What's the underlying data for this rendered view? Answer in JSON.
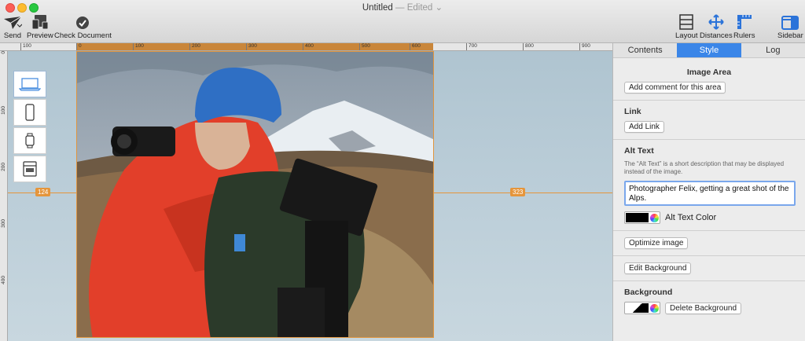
{
  "window": {
    "title": "Untitled",
    "edited": "— Edited",
    "chevron": "⌄"
  },
  "toolbar": {
    "left": [
      {
        "label": "Send",
        "icon": "paper-plane-icon"
      },
      {
        "label": "Preview",
        "icon": "preview-devices-icon"
      },
      {
        "label": "Check Document",
        "icon": "checkmark-circle-icon"
      }
    ],
    "right": [
      {
        "label": "Layout",
        "icon": "layout-icon"
      },
      {
        "label": "Distances",
        "icon": "distances-icon"
      },
      {
        "label": "Rulers",
        "icon": "rulers-icon"
      },
      {
        "label": "Sidebar",
        "icon": "sidebar-icon"
      }
    ]
  },
  "ruler": {
    "h_ticks": [
      "100",
      "0",
      "100",
      "200",
      "300",
      "400",
      "500",
      "600",
      "700",
      "800",
      "900"
    ],
    "v_ticks": [
      "0",
      "100",
      "200",
      "300",
      "400"
    ]
  },
  "canvas": {
    "distance_left": "124",
    "distance_right": "323",
    "devices": [
      "laptop-icon",
      "phone-icon",
      "watch-icon",
      "email-icon"
    ]
  },
  "sidebar": {
    "tabs": [
      "Contents",
      "Style",
      "Log"
    ],
    "active_tab": "Style",
    "image_area": {
      "title": "Image Area",
      "button": "Add comment for this area"
    },
    "link": {
      "title": "Link",
      "button": "Add Link"
    },
    "alt_text": {
      "title": "Alt Text",
      "description": "The “Alt Text” is a short description that may be displayed instead of the image.",
      "value": "Photographer Felix, getting a great shot of the Alps.",
      "color_label": "Alt Text Color",
      "color": "#000000"
    },
    "optimize": {
      "button": "Optimize image"
    },
    "edit_background": {
      "button": "Edit Background"
    },
    "background": {
      "title": "Background",
      "button": "Delete Background"
    }
  },
  "colors": {
    "accent": "#3b86e8",
    "guide": "#e5953b",
    "jacket": "#e8412c",
    "beanie": "#2f6fc4"
  }
}
